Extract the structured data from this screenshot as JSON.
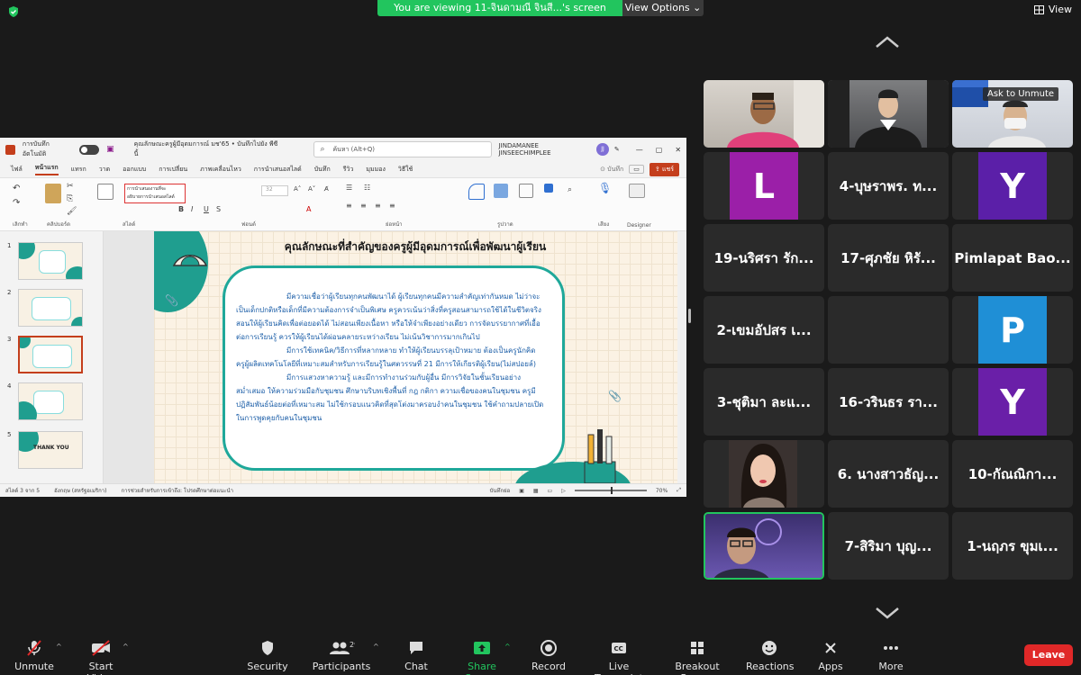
{
  "banner": {
    "text": "You are viewing 11-จินดามณี จินสี...'s screen",
    "view_options": "View Options"
  },
  "top_right": {
    "view_label": "View"
  },
  "ppt": {
    "autosave_label": "การบันทึกอัตโนมัติ",
    "doc_title": "คุณลักษณะครูผู้มีอุดมการณ์ มช'65 • บันทึกไปยัง พีซีนี้",
    "search_placeholder": "ค้นหา (Alt+Q)",
    "user_name": "JINDAMANEE JINSEECHIMPLEE",
    "user_initials": "JJ",
    "tabs": [
      "ไฟล์",
      "หน้าแรก",
      "แทรก",
      "วาด",
      "ออกแบบ",
      "การเปลี่ยน",
      "ภาพเคลื่อนไหว",
      "การนำเสนอสไลด์",
      "บันทึก",
      "รีวิว",
      "มุมมอง",
      "วิธีใช้"
    ],
    "record_label": "บันทึก",
    "share_label": "แชร์",
    "ribbon_groups": [
      "เลิกทำ",
      "คลิปบอร์ด",
      "สไลด์",
      "ฟอนต์",
      "ย่อหน้า",
      "รูปวาด",
      "เสียง",
      "Designer"
    ],
    "font_dropdown": [
      "การนำเสนองานที่จะ",
      "อธิบายการนำเสนอสไลด์"
    ],
    "font_size": "32",
    "slide_numbers": [
      "1",
      "2",
      "3",
      "4",
      "5"
    ],
    "thumb5_text": "THANK YOU",
    "slide_title": "คุณลักษณะที่สำคัญของครูผู้มีอุดมการณ์เพื่อพัฒนาผู้เรียน",
    "slide_paragraphs": [
      "มีความเชื่อว่าผู้เรียนทุกคนพัฒนาได้ ผู้เรียนทุกคนมีความสำคัญเท่ากันหมด ไม่ว่าจะเป็นเด็กปกติหรือเด็กที่มีความต้องการจำเป็นพิเศษ ครูควรเน้นว่าสิ่งที่ครูสอนสามารถใช้ได้ในชีวิตจริง สอนให้ผู้เรียนคิดเพื่อต่อยอดได้ ไม่สอนเพียงเนื้อหา หรือให้จำเพียงอย่างเดียว การจัดบรรยากาศที่เอื้อต่อการเรียนรู้ ควรให้ผู้เรียนได้ผ่อนคลายระหว่างเรียน ไม่เน้นวิชาการมากเกินไป",
      "มีการใช้เทคนิค/วิธีการที่หลากหลาย ทำให้ผู้เรียนบรรลุเป้าหมาย ต้องเป็นครูนักคิด ครูผู้ผลิตเทคโนโลยีที่เหมาะสมสำหรับการเรียนรู้ในศตวรรษที่ 21 มีการให้เกียรติผู้เรียน(ไม่สปอยล์)",
      "มีการแสวงหาความรู้ และมีการทำงานร่วมกับผู้อื่น มีการวิจัยในชั้นเรียนอย่างสม่ำเสมอ ให้ความร่วมมือกับชุมชน ศึกษาบริบทเชิงพื้นที่ กฎ กติกา ความเชื่อของคนในชุมชน ครูมีปฏิสัมพันธ์น้อยต่อที่เหมาะสม ไม่ใช้กรอบแนวคิดที่สุดโต่งมาครอบงำคนในชุมชน ใช้คำถามปลายเปิดในการพูดคุยกับคนในชุมชน"
    ],
    "status_left": "สไลด์ 3 จาก 5",
    "status_lang": "อังกฤษ (สหรัฐอเมริกา)",
    "status_access": "การช่วยสำหรับการเข้าถึง: โปรดศึกษาต่อแนะนำ",
    "status_notes": "บันทึกย่อ",
    "zoom": "70%"
  },
  "gallery": {
    "tiles": [
      {
        "name": "",
        "type": "video",
        "variant": "man-pink"
      },
      {
        "name": "",
        "type": "video",
        "variant": "graduate"
      },
      {
        "name": "Ask to Unmute",
        "type": "video",
        "variant": "mask"
      },
      {
        "name": "L",
        "type": "avatar",
        "color": "#9b1fa8"
      },
      {
        "name": "4-บุษราพร. ท...",
        "type": "name"
      },
      {
        "name": "Y",
        "type": "avatar",
        "color": "#5b1fa8"
      },
      {
        "name": "19-นริศรา รัก...",
        "type": "name"
      },
      {
        "name": "17-ศุภชัย หิรั...",
        "type": "name"
      },
      {
        "name": "Pimlapat Bao...",
        "type": "name"
      },
      {
        "name": "2-เขมอัปสร เ...",
        "type": "name"
      },
      {
        "name": "",
        "type": "blank"
      },
      {
        "name": "P",
        "type": "avatar",
        "color": "#1f8fd6"
      },
      {
        "name": "3-ชุติมา ละแ...",
        "type": "name"
      },
      {
        "name": "16-วรินธร รา...",
        "type": "name"
      },
      {
        "name": "Y",
        "type": "avatar",
        "color": "#6a1fa8"
      },
      {
        "name": "",
        "type": "video",
        "variant": "woman"
      },
      {
        "name": "6. นางสาวธัญ...",
        "type": "name"
      },
      {
        "name": "10-กัณณิกา...",
        "type": "name"
      },
      {
        "name": "",
        "type": "video",
        "variant": "man-purple"
      },
      {
        "name": "7-สิริมา บุญ...",
        "type": "name"
      },
      {
        "name": "1-นฤภร ขุมเ...",
        "type": "name"
      }
    ]
  },
  "toolbar": {
    "unmute": "Unmute",
    "start_video": "Start Video",
    "security": "Security",
    "participants": "Participants",
    "participants_count": "29",
    "chat": "Chat",
    "share_screen": "Share Screen",
    "record": "Record",
    "live_transcript": "Live Transcript",
    "breakout_rooms": "Breakout Rooms",
    "reactions": "Reactions",
    "apps": "Apps",
    "more": "More",
    "leave": "Leave"
  },
  "colors": {
    "accent_green": "#22c55e",
    "leave_red": "#e02828",
    "ppt_red": "#c43e1c",
    "slide_teal": "#1fa89a"
  }
}
